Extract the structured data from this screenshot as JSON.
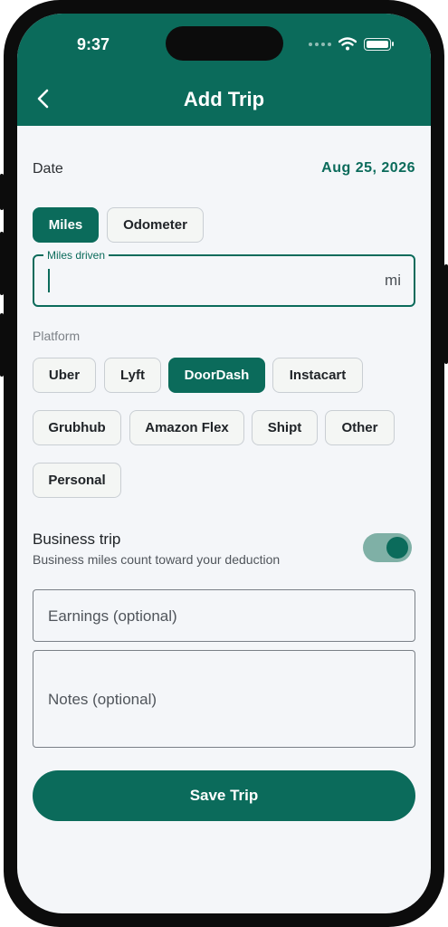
{
  "status_bar": {
    "time": "9:37"
  },
  "header": {
    "title": "Add Trip",
    "back_icon": "chevron-left-icon"
  },
  "date": {
    "label": "Date",
    "value": "Aug 25, 2026"
  },
  "mode": {
    "options": [
      "Miles",
      "Odometer"
    ],
    "selected": "Miles"
  },
  "miles_field": {
    "label": "Miles driven",
    "value": "",
    "unit": "mi"
  },
  "platform": {
    "label": "Platform",
    "options": [
      "Uber",
      "Lyft",
      "DoorDash",
      "Instacart",
      "Grubhub",
      "Amazon Flex",
      "Shipt",
      "Other",
      "Personal"
    ],
    "selected": "DoorDash"
  },
  "business_trip": {
    "title": "Business trip",
    "subtitle": "Business miles count toward your deduction",
    "enabled": true
  },
  "earnings_field": {
    "placeholder": "Earnings (optional)"
  },
  "notes_field": {
    "placeholder": "Notes (optional)"
  },
  "save_button": {
    "label": "Save Trip"
  },
  "colors": {
    "accent": "#0b6b5b",
    "background": "#f4f6f9",
    "switch_track": "#7fb0a6"
  }
}
